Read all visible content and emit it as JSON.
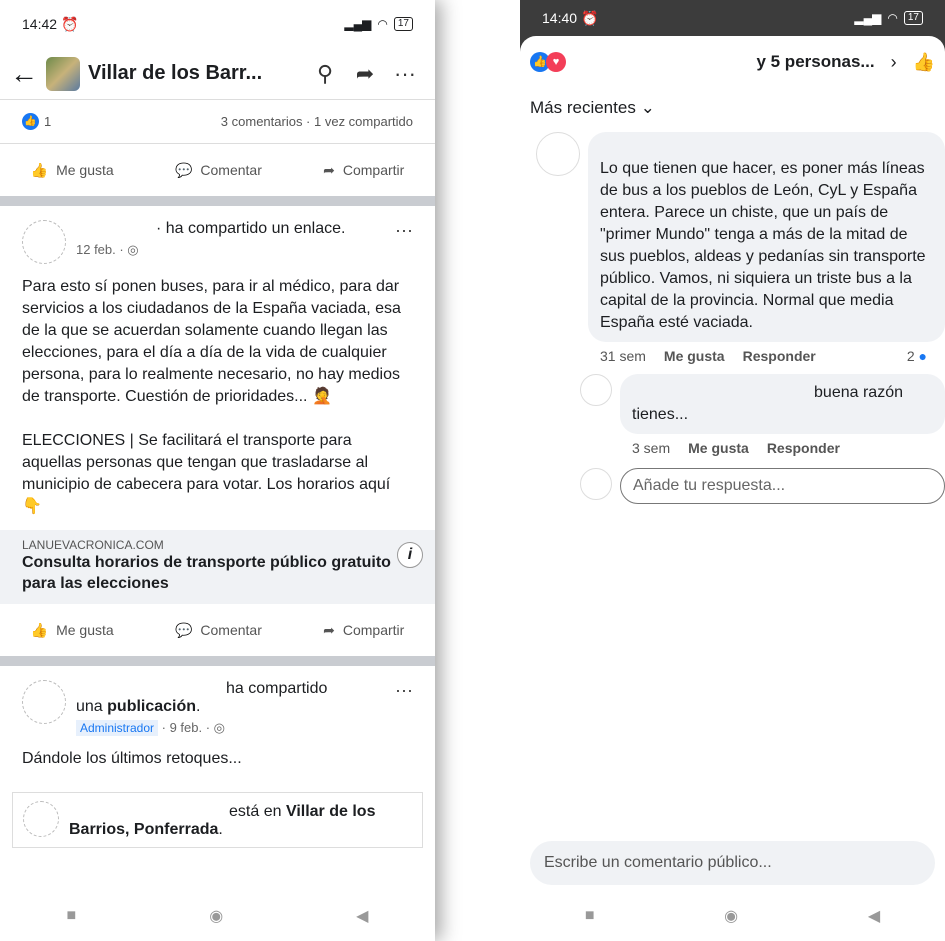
{
  "left": {
    "status": {
      "time": "14:42",
      "battery": "17"
    },
    "topbar": {
      "title": "Villar de los Barr..."
    },
    "stats": {
      "likes": "1",
      "comments_shares": "3 comentarios · 1 vez compartido"
    },
    "actions": {
      "like": "Me gusta",
      "comment": "Comentar",
      "share": "Compartir"
    },
    "post1": {
      "author_action": "· ha compartido un enlace.",
      "date": "12 feb. · ◎",
      "text1": "Para esto sí ponen buses,  para ir al médico,  para dar servicios a los ciudadanos de la España vaciada,  esa de la que se acuerdan solamente cuando llegan las elecciones,  para el día a día de la vida de cualquier persona,  para lo realmente necesario, no hay medios de transporte. Cuestión de prioridades... 🤦",
      "text2": "ELECCIONES | Se facilitará el transporte para aquellas personas que tengan que trasladarse al municipio de cabecera para votar. Los horarios aquí 👇",
      "link_domain": "LANUEVACRONICA.COM",
      "link_title": "Consulta horarios de transporte público gratuito para las elecciones"
    },
    "post2": {
      "action": "ha compartido",
      "action2_pre": "una ",
      "action2_bold": "publicación",
      "badge": "Administrador",
      "date": " · 9 feb. · ◎",
      "text": "Dándole los últimos retoques...",
      "nested_pre": "está en ",
      "nested_place": "Villar de los Barrios, Ponferrada",
      "nested_post": "."
    }
  },
  "right": {
    "status": {
      "time": "14:40",
      "battery": "17"
    },
    "header": {
      "title": "y 5 personas..."
    },
    "sort": "Más recientes",
    "comment1": {
      "text": "Lo que tienen que hacer, es poner más líneas de bus a los pueblos de León, CyL y España entera. Parece un chiste, que un país de \"primer Mundo\" tenga a más de la mitad de sus pueblos, aldeas y pedanías sin transporte público. Vamos, ni siquiera un triste bus a la capital de la provincia. Normal que media España esté vaciada.",
      "time": "31 sem",
      "like": "Me gusta",
      "reply": "Responder",
      "likes": "2"
    },
    "comment2": {
      "text_a": "buena razón",
      "text_b": "tienes...",
      "time": "3 sem",
      "like": "Me gusta",
      "reply": "Responder"
    },
    "reply_placeholder": "Añade tu respuesta...",
    "comment_placeholder": "Escribe un comentario público..."
  }
}
